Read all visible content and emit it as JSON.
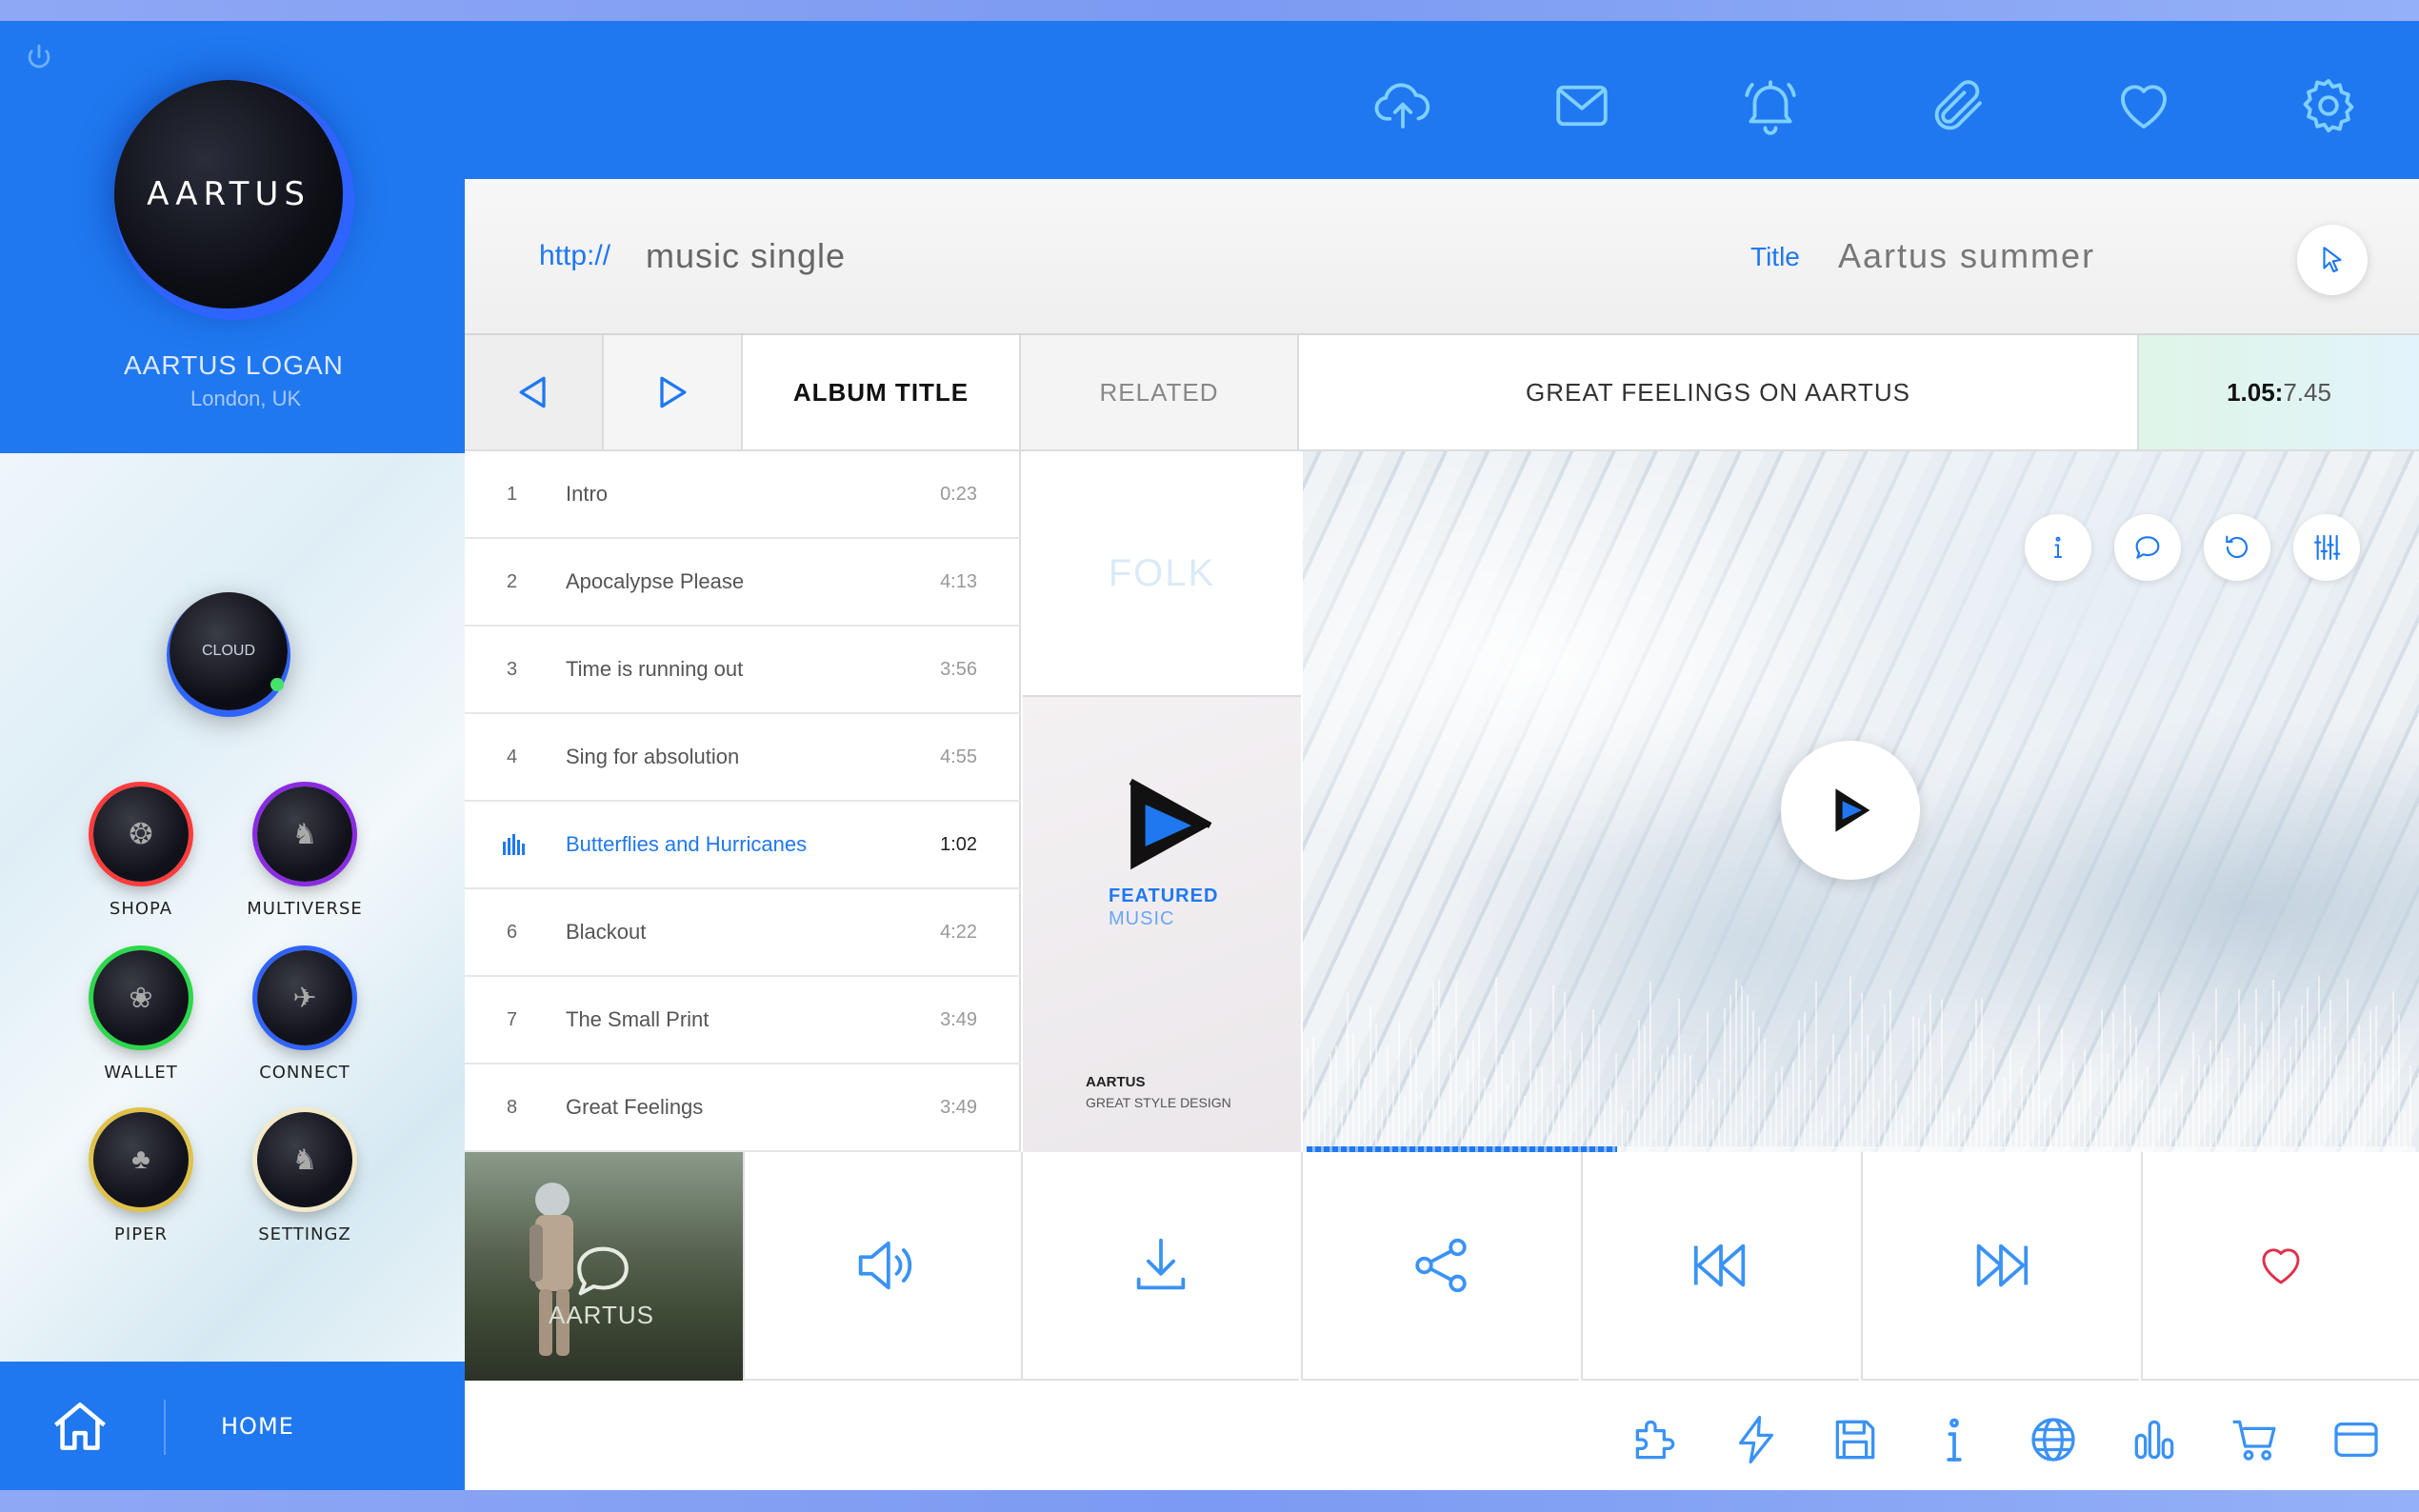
{
  "sidebar": {
    "logo_text": "AARTUS",
    "user_name": "AARTUS LOGAN",
    "user_location": "London, UK",
    "cloud_label": "CLOUD",
    "apps": [
      {
        "label": "SHOPA",
        "ring": "#ff3b3b"
      },
      {
        "label": "MULTIVERSE",
        "ring": "#8a2be2"
      },
      {
        "label": "WALLET",
        "ring": "#2bd84a"
      },
      {
        "label": "CONNECT",
        "ring": "#2f63ff"
      },
      {
        "label": "PIPER",
        "ring": "#e0c24a"
      },
      {
        "label": "SETTINGZ",
        "ring": "#f3e9c9"
      }
    ],
    "home_label": "HOME"
  },
  "topbar": {
    "icons": [
      "cloud-upload-icon",
      "mail-icon",
      "bell-icon",
      "paperclip-icon",
      "heart-icon",
      "gear-icon"
    ]
  },
  "urlbar": {
    "protocol": "http://",
    "url": "music single",
    "title_label": "Title",
    "title_value": "Aartus summer"
  },
  "tabs": {
    "album": "ALBUM TITLE",
    "related": "RELATED",
    "great": "GREAT FEELINGS ON AARTUS",
    "time_current": "1.05:",
    "time_total": "7.45"
  },
  "tracks": [
    {
      "num": "1",
      "title": "Intro",
      "duration": "0:23"
    },
    {
      "num": "2",
      "title": "Apocalypse Please",
      "duration": "4:13"
    },
    {
      "num": "3",
      "title": "Time is running out",
      "duration": "3:56"
    },
    {
      "num": "4",
      "title": "Sing for absolution",
      "duration": "4:55"
    },
    {
      "num": "",
      "title": "Butterflies and Hurricanes",
      "duration": "1:02",
      "active": true
    },
    {
      "num": "6",
      "title": "Blackout",
      "duration": "4:22"
    },
    {
      "num": "7",
      "title": "The Small Print",
      "duration": "3:49"
    },
    {
      "num": "8",
      "title": "Great Feelings",
      "duration": "3:49"
    }
  ],
  "cards": {
    "folk": "FOLK",
    "featured_l1": "FEATURED",
    "featured_l2": "MUSIC",
    "featured_brand": "AARTUS",
    "featured_sub": "GREAT STYLE DESIGN"
  },
  "video": {
    "progress_fraction": 0.28,
    "overlay_icons": [
      "info-icon",
      "chat-icon",
      "refresh-icon",
      "equalizer-icon"
    ]
  },
  "photo_tile": {
    "label": "AARTUS"
  },
  "controls": [
    "volume-icon",
    "download-icon",
    "share-icon",
    "rewind-icon",
    "fast-forward-icon",
    "heart-icon"
  ],
  "bottombar": {
    "icons": [
      "puzzle-icon",
      "lightning-icon",
      "save-icon",
      "info-icon",
      "globe-icon",
      "bar-chart-icon",
      "cart-icon",
      "card-icon"
    ]
  },
  "colors": {
    "accent": "#1f78f0",
    "heart": "#e0304a"
  }
}
